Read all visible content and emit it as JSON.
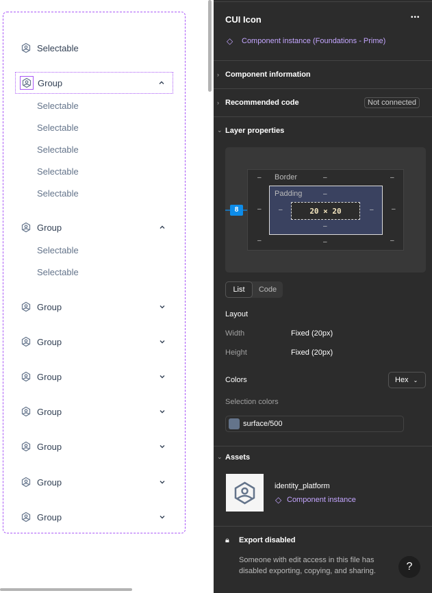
{
  "canvas": {
    "items": [
      {
        "type": "item",
        "label": "Selectable"
      },
      {
        "type": "group",
        "label": "Group",
        "expanded": true,
        "selected": true,
        "children": [
          "Selectable",
          "Selectable",
          "Selectable",
          "Selectable",
          "Selectable"
        ]
      },
      {
        "type": "group",
        "label": "Group",
        "expanded": true,
        "children": [
          "Selectable",
          "Selectable"
        ]
      },
      {
        "type": "group",
        "label": "Group",
        "expanded": false
      },
      {
        "type": "group",
        "label": "Group",
        "expanded": false
      },
      {
        "type": "group",
        "label": "Group",
        "expanded": false
      },
      {
        "type": "group",
        "label": "Group",
        "expanded": false
      },
      {
        "type": "group",
        "label": "Group",
        "expanded": false
      },
      {
        "type": "group",
        "label": "Group",
        "expanded": false
      },
      {
        "type": "group",
        "label": "Group",
        "expanded": false
      }
    ]
  },
  "panel": {
    "title": "CUI Icon",
    "more": "•••",
    "instance": "Component instance (Foundations - Prime)",
    "component_information": "Component information",
    "recommended_code": "Recommended code",
    "not_connected": "Not connected",
    "layer_properties": "Layer properties",
    "box": {
      "border": "Border",
      "padding": "Padding",
      "size": "20 × 20",
      "margin_left": "8",
      "dash": "–"
    },
    "tabs": [
      "List",
      "Code"
    ],
    "layout": "Layout",
    "width_label": "Width",
    "width_value": "Fixed (20px)",
    "height_label": "Height",
    "height_value": "Fixed (20px)",
    "colors": "Colors",
    "color_format": "Hex",
    "selection_colors": "Selection colors",
    "color_token": "surface/500",
    "color_swatch": "#64748b",
    "assets": "Assets",
    "asset_name": "identity_platform",
    "asset_type": "Component instance",
    "export_title": "Export disabled",
    "export_text": "Someone with edit access in this file has disabled exporting, copying, and sharing.",
    "help": "?"
  },
  "colors": {
    "accent": "#a855f7",
    "purple_text": "#c4a6ff",
    "panel_bg": "#2c2c2c",
    "blue": "#0d8ce9"
  }
}
